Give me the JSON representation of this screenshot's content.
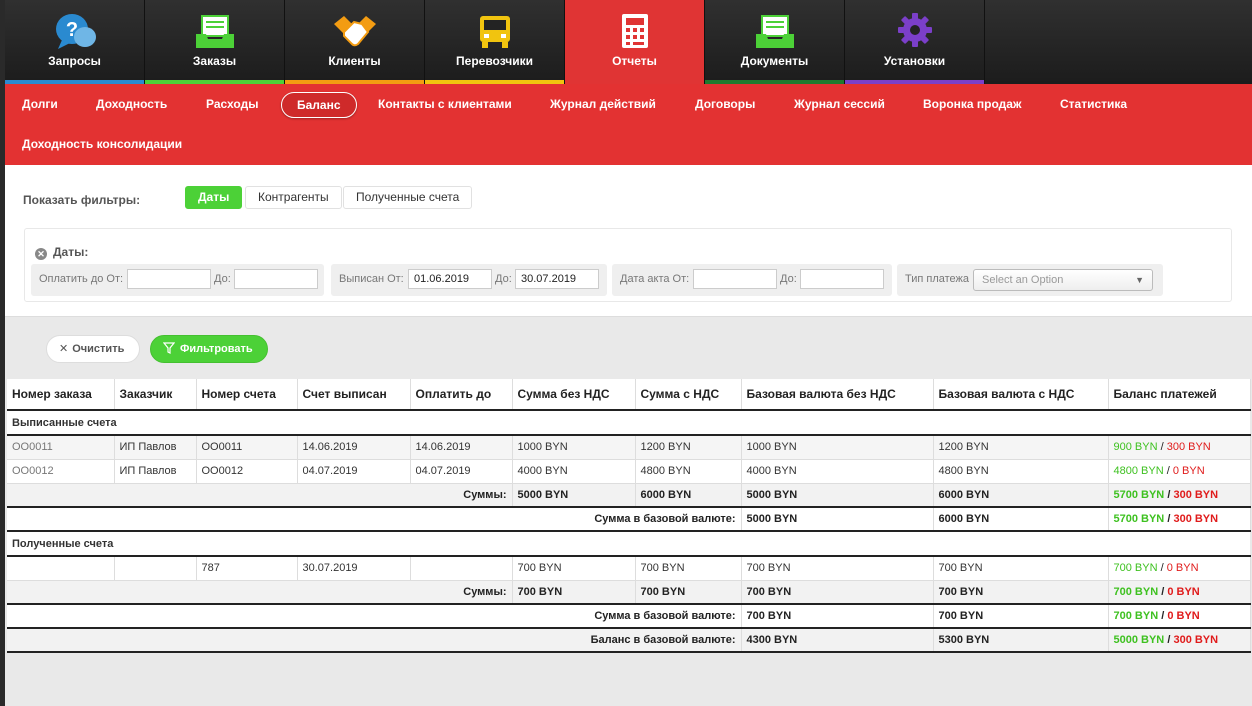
{
  "topnav": {
    "items": [
      {
        "label": "Запросы",
        "icon": "question-bubble-icon",
        "bar": "#2a8ad0"
      },
      {
        "label": "Заказы",
        "icon": "inbox-tray-icon",
        "bar": "#4cd137"
      },
      {
        "label": "Клиенты",
        "icon": "handshake-icon",
        "bar": "#f39c12"
      },
      {
        "label": "Перевозчики",
        "icon": "truck-icon",
        "bar": "#f1c40f"
      },
      {
        "label": "Отчеты",
        "icon": "calculator-icon",
        "bar": "#e03434"
      },
      {
        "label": "Документы",
        "icon": "inbox-tray-icon",
        "bar": "#1e7a2e"
      },
      {
        "label": "Установки",
        "icon": "gear-icon",
        "bar": "#7b3fc9"
      }
    ]
  },
  "subnav": {
    "items": [
      "Долги",
      "Доходность",
      "Расходы",
      "Баланс",
      "Контакты с клиентами",
      "Журнал действий",
      "Договоры",
      "Журнал сессий",
      "Воронка продаж",
      "Статистика",
      "Доходность консолидации"
    ],
    "active": "Баланс"
  },
  "filters": {
    "show_label": "Показать фильтры:",
    "tabs": [
      "Даты",
      "Контрагенты",
      "Полученные счета"
    ],
    "dates_title": "Даты:",
    "pay_from_label": "Оплатить до От:",
    "pay_to_label": "До:",
    "pay_from": "",
    "pay_to": "",
    "issued_from_label": "Выписан От:",
    "issued_to_label": "До:",
    "issued_from": "01.06.2019",
    "issued_to": "30.07.2019",
    "act_from_label": "Дата акта От:",
    "act_to_label": "До:",
    "act_from": "",
    "act_to": "",
    "pay_type_label": "Тип платежа",
    "pay_type_placeholder": "Select an Option"
  },
  "actions": {
    "clear": "Очистить",
    "filter": "Фильтровать"
  },
  "table": {
    "headers": [
      "Номер заказа",
      "Заказчик",
      "Номер счета",
      "Счет выписан",
      "Оплатить до",
      "Сумма без НДС",
      "Сумма с НДС",
      "Базовая валюта без НДС",
      "Базовая валюта с НДС",
      "Баланс платежей"
    ],
    "issued": {
      "title": "Выписанные счета",
      "rows": [
        {
          "order": "OO0011",
          "customer": "ИП Павлов",
          "invoice": "OO0011",
          "issued": "14.06.2019",
          "due": "14.06.2019",
          "net": "1000 BYN",
          "gross": "1200 BYN",
          "base_net": "1000 BYN",
          "base_gross": "1200 BYN",
          "bal_paid": "900 BYN",
          "bal_due": "300 BYN"
        },
        {
          "order": "OO0012",
          "customer": "ИП Павлов",
          "invoice": "OO0012",
          "issued": "04.07.2019",
          "due": "04.07.2019",
          "net": "4000 BYN",
          "gross": "4800 BYN",
          "base_net": "4000 BYN",
          "base_gross": "4800 BYN",
          "bal_paid": "4800 BYN",
          "bal_due": "0 BYN"
        }
      ],
      "sum_label": "Суммы:",
      "sum": {
        "net": "5000 BYN",
        "gross": "6000 BYN",
        "base_net": "5000 BYN",
        "base_gross": "6000 BYN",
        "bal_paid": "5700 BYN",
        "bal_due": "300 BYN"
      },
      "base_label": "Сумма в базовой валюте:",
      "base": {
        "base_net": "5000 BYN",
        "base_gross": "6000 BYN",
        "bal_paid": "5700 BYN",
        "bal_due": "300 BYN"
      }
    },
    "received": {
      "title": "Полученные счета",
      "rows": [
        {
          "order": "",
          "customer": "",
          "invoice": "787",
          "issued": "30.07.2019",
          "due": "",
          "net": "700 BYN",
          "gross": "700 BYN",
          "base_net": "700 BYN",
          "base_gross": "700 BYN",
          "bal_paid": "700 BYN",
          "bal_due": "0 BYN"
        }
      ],
      "sum_label": "Суммы:",
      "sum": {
        "net": "700 BYN",
        "gross": "700 BYN",
        "base_net": "700 BYN",
        "base_gross": "700 BYN",
        "bal_paid": "700 BYN",
        "bal_due": "0 BYN"
      },
      "base_label": "Сумма в базовой валюте:",
      "base": {
        "base_net": "700 BYN",
        "base_gross": "700 BYN",
        "bal_paid": "700 BYN",
        "bal_due": "0 BYN"
      }
    },
    "final_label": "Баланс в базовой валюте:",
    "final": {
      "base_net": "4300 BYN",
      "base_gross": "5300 BYN",
      "bal_paid": "5000 BYN",
      "bal_due": "300 BYN"
    },
    "slash": "/"
  },
  "colors": {
    "accent_red": "#e33232",
    "green": "#4cd137",
    "paid_green": "#3ec120",
    "due_red": "#e01b1b"
  }
}
